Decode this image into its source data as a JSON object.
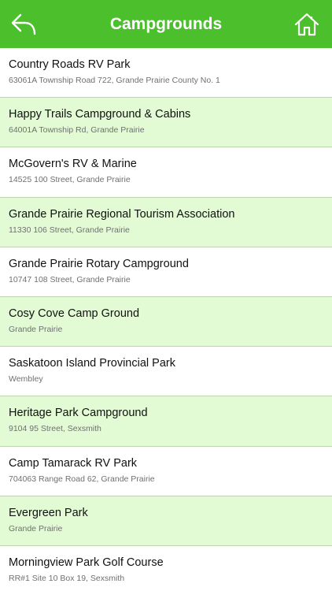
{
  "header": {
    "title": "Campgrounds",
    "back_icon": "back-arrow-icon",
    "home_icon": "home-icon",
    "bar_color": "#4cbf2c"
  },
  "list": {
    "row_color_alt": "#e2fbd4",
    "items": [
      {
        "name": "Country Roads RV Park",
        "address": "63061A Township Road 722, Grande Prairie County No. 1"
      },
      {
        "name": "Happy Trails Campground & Cabins",
        "address": "64001A Township Rd, Grande Prairie"
      },
      {
        "name": "McGovern's RV & Marine",
        "address": "14525 100 Street, Grande Prairie"
      },
      {
        "name": "Grande Prairie Regional Tourism Association",
        "address": "11330 106 Street, Grande Prairie"
      },
      {
        "name": "Grande Prairie Rotary Campground",
        "address": "10747 108 Street, Grande Prairie"
      },
      {
        "name": "Cosy Cove Camp Ground",
        "address": "Grande Prairie"
      },
      {
        "name": "Saskatoon Island Provincial Park",
        "address": "Wembley"
      },
      {
        "name": "Heritage Park Campground",
        "address": "9104 95 Street, Sexsmith"
      },
      {
        "name": "Camp Tamarack RV Park",
        "address": "704063 Range Road 62, Grande Prairie"
      },
      {
        "name": "Evergreen Park",
        "address": "Grande Prairie"
      },
      {
        "name": "Morningview Park Golf Course",
        "address": "RR#1 Site 10 Box 19, Sexsmith"
      }
    ]
  }
}
